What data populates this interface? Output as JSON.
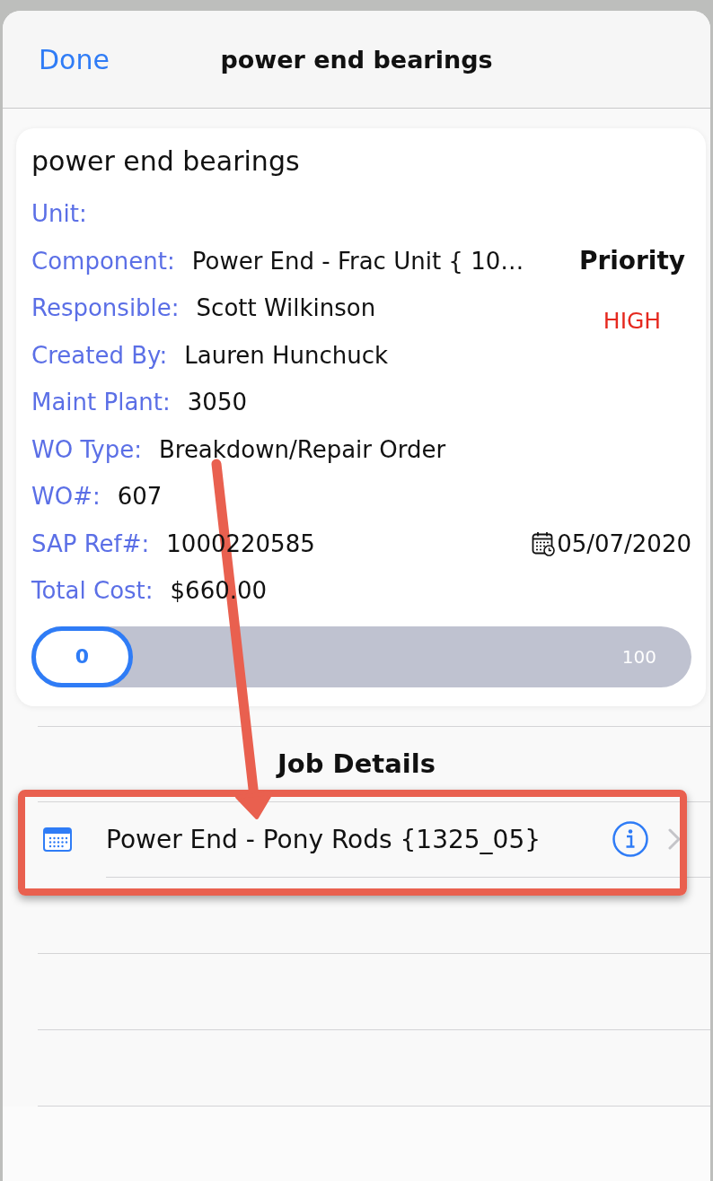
{
  "nav": {
    "done": "Done",
    "title": "power end bearings"
  },
  "card": {
    "title": "power end bearings",
    "fields": [
      {
        "label": "Unit:"
      },
      {
        "label": "Component:",
        "value": "Power End - Frac Unit { 10…"
      },
      {
        "label": "Responsible:",
        "value": "Scott Wilkinson"
      },
      {
        "label": "Created By:",
        "value": "Lauren Hunchuck"
      },
      {
        "label": "Maint Plant:",
        "value": "3050"
      },
      {
        "label": "WO Type:",
        "value": "Breakdown/Repair Order"
      },
      {
        "label": "WO#:",
        "value": "607"
      },
      {
        "label": "SAP Ref#:",
        "value": "1000220585"
      },
      {
        "label": "Total Cost:",
        "value": "$660.00"
      }
    ],
    "priority": {
      "label": "Priority",
      "value": "HIGH"
    },
    "date": "05/07/2020",
    "progress": {
      "value": "0",
      "max": "100",
      "level": 0
    }
  },
  "job_details": {
    "title": "Job Details",
    "items": [
      {
        "text": "Power End - Pony Rods {1325_05}",
        "highlighted": true
      }
    ]
  },
  "annotations": [
    {
      "kind": "arrow"
    }
  ]
}
